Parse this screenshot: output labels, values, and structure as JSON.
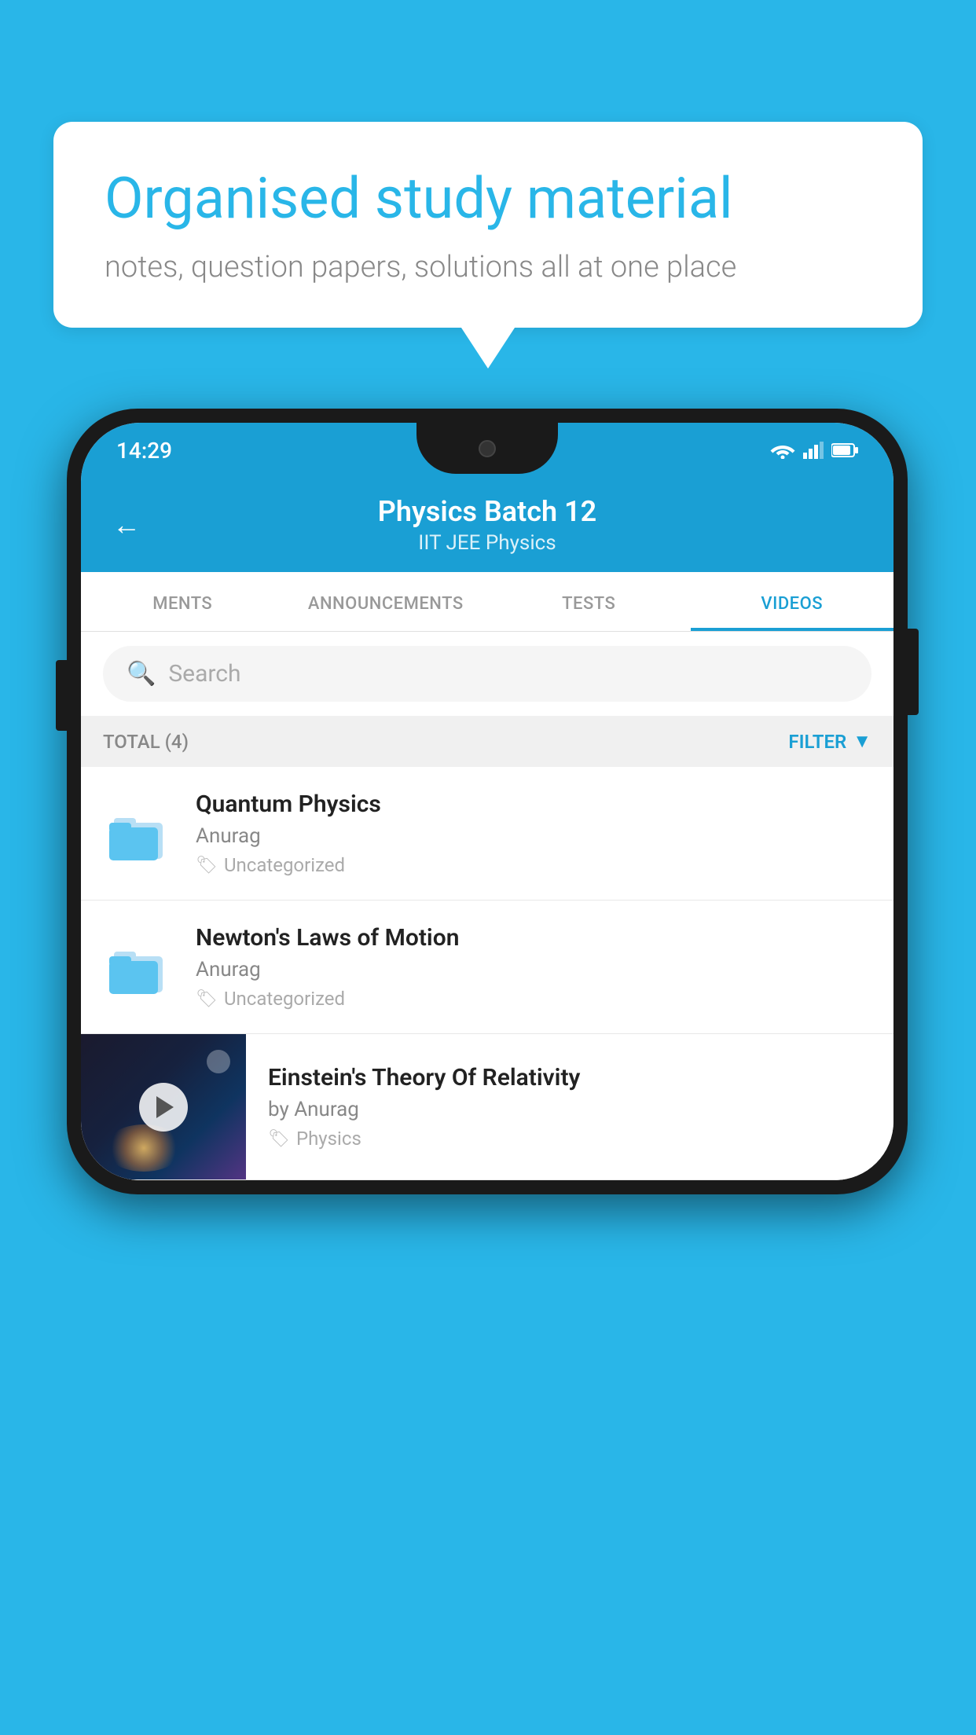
{
  "background_color": "#29b6e8",
  "bubble": {
    "title": "Organised study material",
    "subtitle": "notes, question papers, solutions all at one place"
  },
  "phone": {
    "status_bar": {
      "time": "14:29"
    },
    "header": {
      "title": "Physics Batch 12",
      "subtitle": "IIT JEE   Physics",
      "back_label": "←"
    },
    "tabs": [
      {
        "label": "MENTS",
        "active": false
      },
      {
        "label": "ANNOUNCEMENTS",
        "active": false
      },
      {
        "label": "TESTS",
        "active": false
      },
      {
        "label": "VIDEOS",
        "active": true
      }
    ],
    "search": {
      "placeholder": "Search"
    },
    "filter": {
      "total_label": "TOTAL (4)",
      "filter_label": "FILTER"
    },
    "videos": [
      {
        "title": "Quantum Physics",
        "author": "Anurag",
        "tag": "Uncategorized",
        "has_thumb": false
      },
      {
        "title": "Newton's Laws of Motion",
        "author": "Anurag",
        "tag": "Uncategorized",
        "has_thumb": false
      },
      {
        "title": "Einstein's Theory Of Relativity",
        "author": "by Anurag",
        "tag": "Physics",
        "has_thumb": true
      }
    ]
  }
}
